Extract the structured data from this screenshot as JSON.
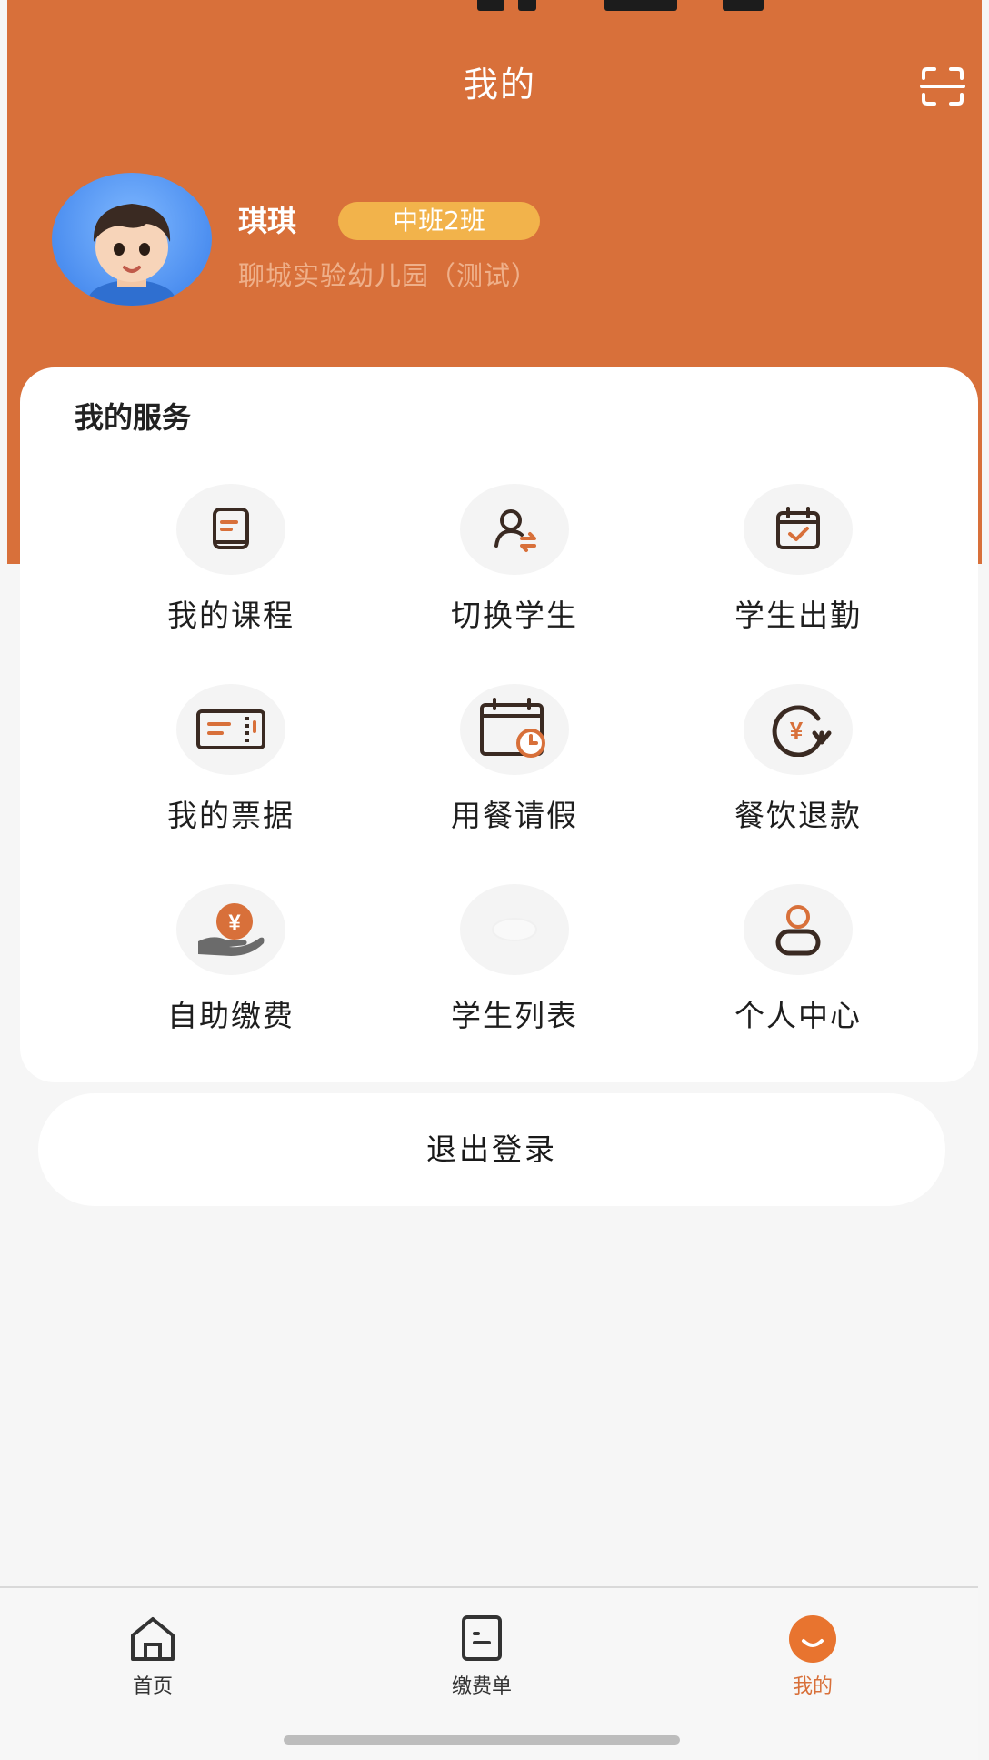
{
  "colors": {
    "brand": "#d8703a",
    "badge": "#f2b34b",
    "background": "#f6f6f6"
  },
  "header": {
    "title": "我的",
    "scan_icon": "scan-icon"
  },
  "profile": {
    "name": "琪琪",
    "class_badge": "中班2班",
    "school": "聊城实验幼儿园（测试）"
  },
  "services": {
    "title": "我的服务",
    "items": [
      {
        "label": "我的课程",
        "icon": "book-icon"
      },
      {
        "label": "切换学生",
        "icon": "switch-user-icon"
      },
      {
        "label": "学生出勤",
        "icon": "calendar-check-icon"
      },
      {
        "label": "我的票据",
        "icon": "ticket-icon"
      },
      {
        "label": "用餐请假",
        "icon": "calendar-clock-icon"
      },
      {
        "label": "餐饮退款",
        "icon": "refund-icon"
      },
      {
        "label": "自助缴费",
        "icon": "pay-hand-icon"
      },
      {
        "label": "学生列表",
        "icon": "list-icon"
      },
      {
        "label": "个人中心",
        "icon": "person-icon"
      }
    ]
  },
  "logout": {
    "label": "退出登录"
  },
  "tabbar": {
    "items": [
      {
        "label": "首页",
        "icon": "home-icon"
      },
      {
        "label": "缴费单",
        "icon": "bill-icon"
      },
      {
        "label": "我的",
        "icon": "smile-icon"
      }
    ],
    "active": "我的"
  }
}
